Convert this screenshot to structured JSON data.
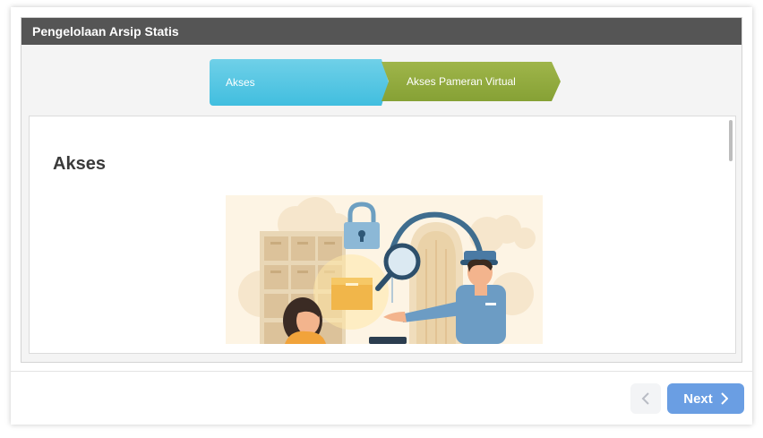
{
  "panel": {
    "title": "Pengelolaan Arsip Statis"
  },
  "steps": [
    {
      "label": "Akses",
      "active": true,
      "color": "#4cc2e2"
    },
    {
      "label": "Akses Pameran Virtual",
      "active": false,
      "color": "#8ea63c"
    }
  ],
  "content": {
    "title": "Akses"
  },
  "illustration": {
    "icon": "archive-access-illustration"
  },
  "footer": {
    "prev_icon": "chevron-left-icon",
    "next_label": "Next",
    "next_icon": "chevron-right-icon",
    "next_color": "#6a9ee3"
  }
}
